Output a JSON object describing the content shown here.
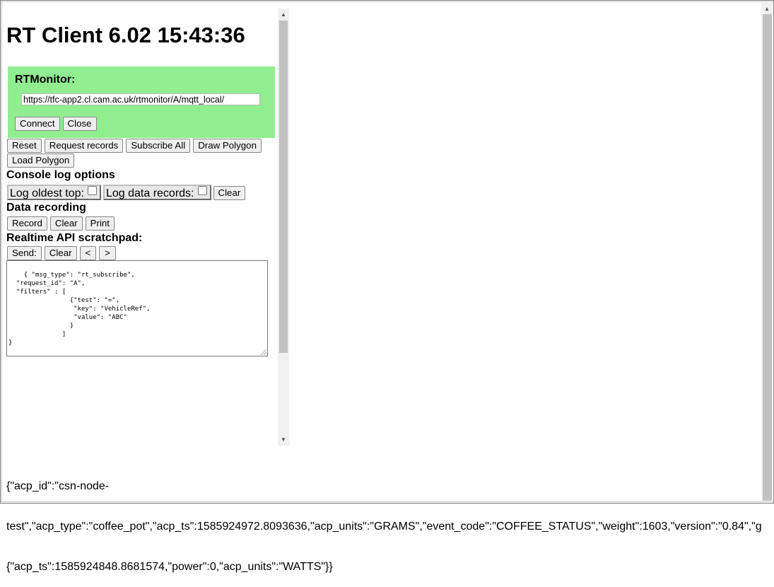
{
  "header": {
    "title": "RT Client 6.02 15:43:36"
  },
  "rtmonitor": {
    "label": "RTMonitor:",
    "url": "https://tfc-app2.cl.cam.ac.uk/rtmonitor/A/mqtt_local/",
    "connect_label": "Connect",
    "close_label": "Close"
  },
  "toolbar": {
    "reset_label": "Reset",
    "request_records_label": "Request records",
    "subscribe_all_label": "Subscribe All",
    "draw_polygon_label": "Draw Polygon",
    "load_polygon_label": "Load Polygon"
  },
  "console_log": {
    "heading": "Console log options",
    "log_oldest_top_label": "Log oldest top:",
    "log_oldest_top_checked": false,
    "log_data_records_label": "Log data records:",
    "log_data_records_checked": false,
    "clear_label": "Clear"
  },
  "data_recording": {
    "heading": "Data recording",
    "record_label": "Record",
    "clear_label": "Clear",
    "print_label": "Print"
  },
  "scratchpad": {
    "heading": "Realtime API scratchpad:",
    "send_label": "Send:",
    "clear_label": "Clear",
    "prev_label": "<",
    "next_label": ">",
    "content": "{ \"msg_type\": \"rt_subscribe\",\n  \"request_id\": \"A\",\n  \"filters\" : [\n                {\"test\": \"=\",\n                 \"key\": \"VehicleRef\",\n                 \"value\": \"ABC\"\n                }\n              ]\n}"
  },
  "log": {
    "line1": "{\"acp_id\":\"csn-node-",
    "line2": "test\",\"acp_type\":\"coffee_pot\",\"acp_ts\":1585924972.8093636,\"acp_units\":\"GRAMS\",\"event_code\":\"COFFEE_STATUS\",\"weight\":1603,\"version\":\"0.84\",\"g",
    "line3": "{\"acp_ts\":1585924848.8681574,\"power\":0,\"acp_units\":\"WATTS\"}}"
  },
  "colors": {
    "rtmonitor_bg": "#90ee90",
    "scrollbar_thumb": "#c1c1c1"
  },
  "icons": {
    "scroll_up": "triangle-up-icon",
    "scroll_down": "triangle-down-icon"
  }
}
